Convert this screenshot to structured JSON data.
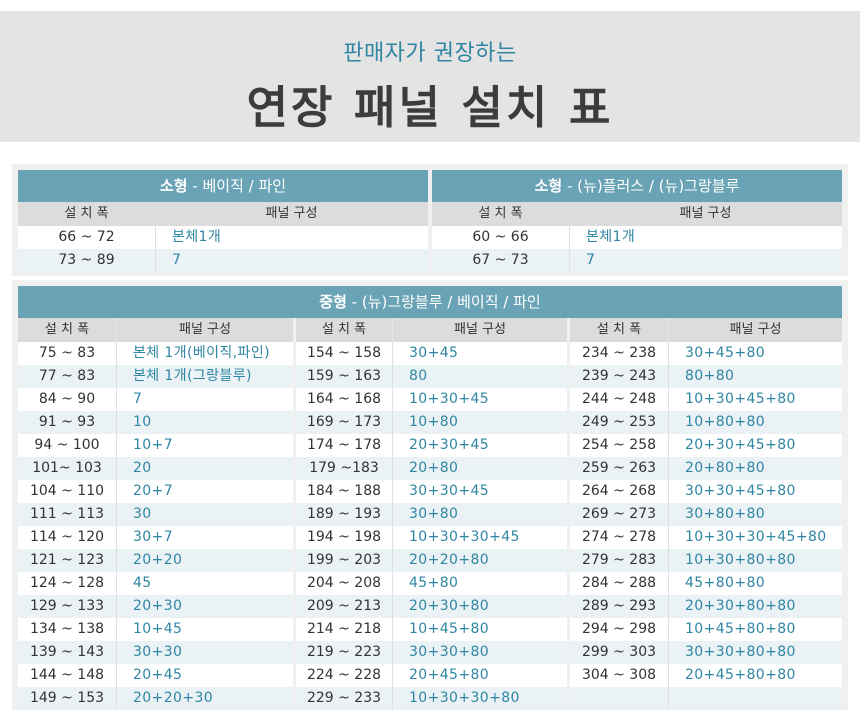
{
  "header": {
    "subtitle": "판매자가 권장하는",
    "title": "연장 패널 설치 표"
  },
  "small_left": {
    "caption_bold": "소형",
    "caption_rest": " - 베이직  / 파인",
    "col_width": "설 치 폭",
    "col_panel": "패널 구성",
    "rows": [
      {
        "width": "66 ~ 72",
        "panel": "본체1개"
      },
      {
        "width": "73 ~ 89",
        "panel": "7"
      }
    ]
  },
  "small_right": {
    "caption_bold": "소형",
    "caption_rest": " - (뉴)플러스 / (뉴)그랑블루",
    "col_width": "설 치 폭",
    "col_panel": "패널 구성",
    "rows": [
      {
        "width": "60 ~ 66",
        "panel": "본체1개"
      },
      {
        "width": "67 ~ 73",
        "panel": "7"
      }
    ]
  },
  "medium": {
    "caption_bold": "중형",
    "caption_rest": " - (뉴)그랑블루 / 베이직 / 파인",
    "col_width": "설 치 폭",
    "col_panel": "패널 구성",
    "columns": [
      [
        {
          "width": "75 ~ 83",
          "panel": "본체 1개(베이직,파인)"
        },
        {
          "width": "77 ~ 83",
          "panel": "본체 1개(그랑블루)"
        },
        {
          "width": "84 ~ 90",
          "panel": "7"
        },
        {
          "width": "91 ~ 93",
          "panel": "10"
        },
        {
          "width": "94 ~ 100",
          "panel": "10+7"
        },
        {
          "width": "101~ 103",
          "panel": "20"
        },
        {
          "width": "104 ~ 110",
          "panel": "20+7"
        },
        {
          "width": "111 ~ 113",
          "panel": "30"
        },
        {
          "width": "114 ~ 120",
          "panel": "30+7"
        },
        {
          "width": "121 ~ 123",
          "panel": "20+20"
        },
        {
          "width": "124 ~ 128",
          "panel": "45"
        },
        {
          "width": "129 ~ 133",
          "panel": "20+30"
        },
        {
          "width": "134 ~ 138",
          "panel": "10+45"
        },
        {
          "width": "139 ~ 143",
          "panel": "30+30"
        },
        {
          "width": "144 ~ 148",
          "panel": "20+45"
        },
        {
          "width": "149 ~ 153",
          "panel": "20+20+30"
        }
      ],
      [
        {
          "width": "154 ~ 158",
          "panel": "30+45"
        },
        {
          "width": "159 ~ 163",
          "panel": "80"
        },
        {
          "width": "164 ~ 168",
          "panel": "10+30+45"
        },
        {
          "width": "169 ~ 173",
          "panel": "10+80"
        },
        {
          "width": "174 ~ 178",
          "panel": "20+30+45"
        },
        {
          "width": "179  ~183",
          "panel": "20+80"
        },
        {
          "width": "184 ~ 188",
          "panel": "30+30+45"
        },
        {
          "width": "189 ~ 193",
          "panel": "30+80"
        },
        {
          "width": "194 ~ 198",
          "panel": "10+30+30+45"
        },
        {
          "width": "199 ~ 203",
          "panel": "20+20+80"
        },
        {
          "width": "204 ~ 208",
          "panel": "45+80"
        },
        {
          "width": "209 ~ 213",
          "panel": "20+30+80"
        },
        {
          "width": "214 ~ 218",
          "panel": "10+45+80"
        },
        {
          "width": "219 ~ 223",
          "panel": "30+30+80"
        },
        {
          "width": "224 ~ 228",
          "panel": "20+45+80"
        },
        {
          "width": "229 ~ 233",
          "panel": "10+30+30+80"
        }
      ],
      [
        {
          "width": "234 ~ 238",
          "panel": "30+45+80"
        },
        {
          "width": "239 ~ 243",
          "panel": "80+80"
        },
        {
          "width": "244 ~ 248",
          "panel": "10+30+45+80"
        },
        {
          "width": "249 ~ 253",
          "panel": "10+80+80"
        },
        {
          "width": "254 ~ 258",
          "panel": "20+30+45+80"
        },
        {
          "width": "259 ~ 263",
          "panel": "20+80+80"
        },
        {
          "width": "264 ~ 268",
          "panel": "30+30+45+80"
        },
        {
          "width": "269 ~ 273",
          "panel": "30+80+80"
        },
        {
          "width": "274 ~ 278",
          "panel": "10+30+30+45+80"
        },
        {
          "width": "279 ~ 283",
          "panel": "10+30+80+80"
        },
        {
          "width": "284 ~ 288",
          "panel": "45+80+80"
        },
        {
          "width": "289 ~ 293",
          "panel": "20+30+80+80"
        },
        {
          "width": "294 ~ 298",
          "panel": "10+45+80+80"
        },
        {
          "width": "299 ~ 303",
          "panel": "30+30+80+80"
        },
        {
          "width": "304 ~ 308",
          "panel": "20+45+80+80"
        },
        {
          "width": "",
          "panel": ""
        }
      ]
    ]
  }
}
